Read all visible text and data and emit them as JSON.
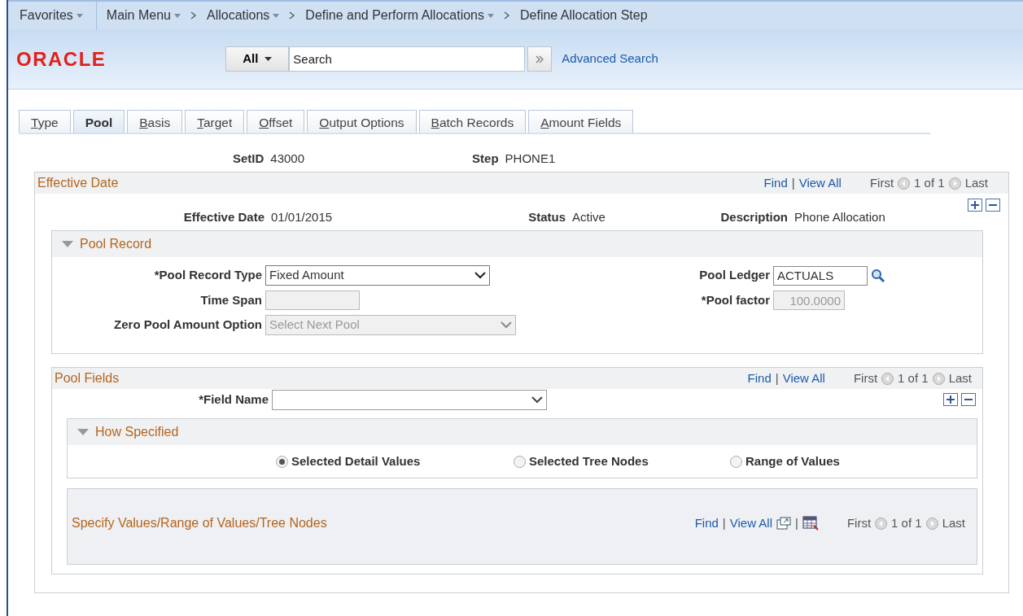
{
  "breadcrumbs": [
    {
      "label": "Favorites",
      "dropdown": true
    },
    {
      "label": "Main Menu",
      "dropdown": true
    },
    {
      "label": "Allocations",
      "dropdown": true
    },
    {
      "label": "Define and Perform Allocations",
      "dropdown": true
    },
    {
      "label": "Define Allocation Step",
      "dropdown": false
    }
  ],
  "logo": "ORACLE",
  "search": {
    "scope": "All",
    "value": "Search",
    "advanced_link": "Advanced Search"
  },
  "tabs": [
    {
      "label": "Type",
      "selected": false
    },
    {
      "label": "Pool",
      "selected": true
    },
    {
      "label": "Basis",
      "selected": false
    },
    {
      "label": "Target",
      "selected": false
    },
    {
      "label": "Offset",
      "selected": false
    },
    {
      "label": "Output Options",
      "selected": false
    },
    {
      "label": "Batch Records",
      "selected": false
    },
    {
      "label": "Amount Fields",
      "selected": false
    }
  ],
  "header_fields": [
    {
      "label": "SetID",
      "value": "43000"
    },
    {
      "label": "Step",
      "value": "PHONE1"
    }
  ],
  "effective_date": {
    "title": "Effective Date",
    "nav": {
      "find": "Find",
      "separator": "|",
      "view_all": "View All",
      "first": "First",
      "count": "1 of 1",
      "last": "Last"
    },
    "fields": [
      {
        "label": "Effective Date",
        "value": "01/01/2015"
      },
      {
        "label": "Status",
        "value": "Active"
      },
      {
        "label": "Description",
        "value": "Phone Allocation"
      }
    ],
    "pool_record": {
      "title": "Pool Record",
      "expanded": true,
      "left_fields": [
        {
          "kind": "select",
          "label": "*Pool Record Type",
          "value": "Fixed Amount",
          "disabled": false
        },
        {
          "kind": "input",
          "label": "Time Span",
          "disabled": true
        },
        {
          "kind": "select",
          "label": "Zero Pool Amount Option",
          "value": "Select Next Pool",
          "disabled": true
        }
      ],
      "right_fields": [
        {
          "kind": "lookup",
          "label": "Pool Ledger",
          "value": "ACTUALS",
          "disabled": false
        },
        {
          "kind": "input",
          "label": "*Pool factor",
          "value": "100.0000",
          "disabled": true
        }
      ]
    },
    "pool_fields": {
      "title": "Pool Fields",
      "nav": {
        "find": "Find",
        "separator": "|",
        "view_all": "View All",
        "first": "First",
        "count": "1 of 1",
        "last": "Last"
      },
      "field_name": {
        "label": "*Field Name",
        "disabled": false
      },
      "how_specified": {
        "title": "How Specified",
        "expanded": true,
        "options": [
          {
            "label": "Selected Detail Values",
            "selected": true
          },
          {
            "label": "Selected Tree Nodes",
            "selected": false
          },
          {
            "label": "Range of Values",
            "selected": false
          }
        ]
      },
      "values_grid": {
        "title": "Specify Values/Range of Values/Tree Nodes",
        "nav": {
          "find": "Find",
          "separator": "|",
          "view_all": "View All",
          "separator_2": "|",
          "first": "First",
          "count": "1 of 1",
          "last": "Last"
        }
      }
    }
  }
}
